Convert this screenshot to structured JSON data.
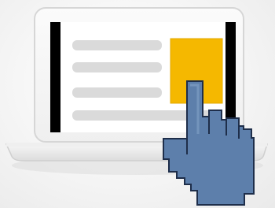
{
  "illustration": {
    "subject": "laptop-with-touch-hand",
    "colors": {
      "background": "#f1f1f1",
      "laptop_body": "#f3f3f3",
      "laptop_edge": "#d7d7d7",
      "screen_bezel": "#000000",
      "screen_background": "#ffffff",
      "placeholder_line": "#dadada",
      "accent_block": "#f5b800",
      "accent_block_edge": "#e2a900",
      "hand_fill": "#5d7fab",
      "hand_outline": "#1e2e4a"
    },
    "placeholder_line_count": 4,
    "icon": "pointer-hand-icon"
  }
}
